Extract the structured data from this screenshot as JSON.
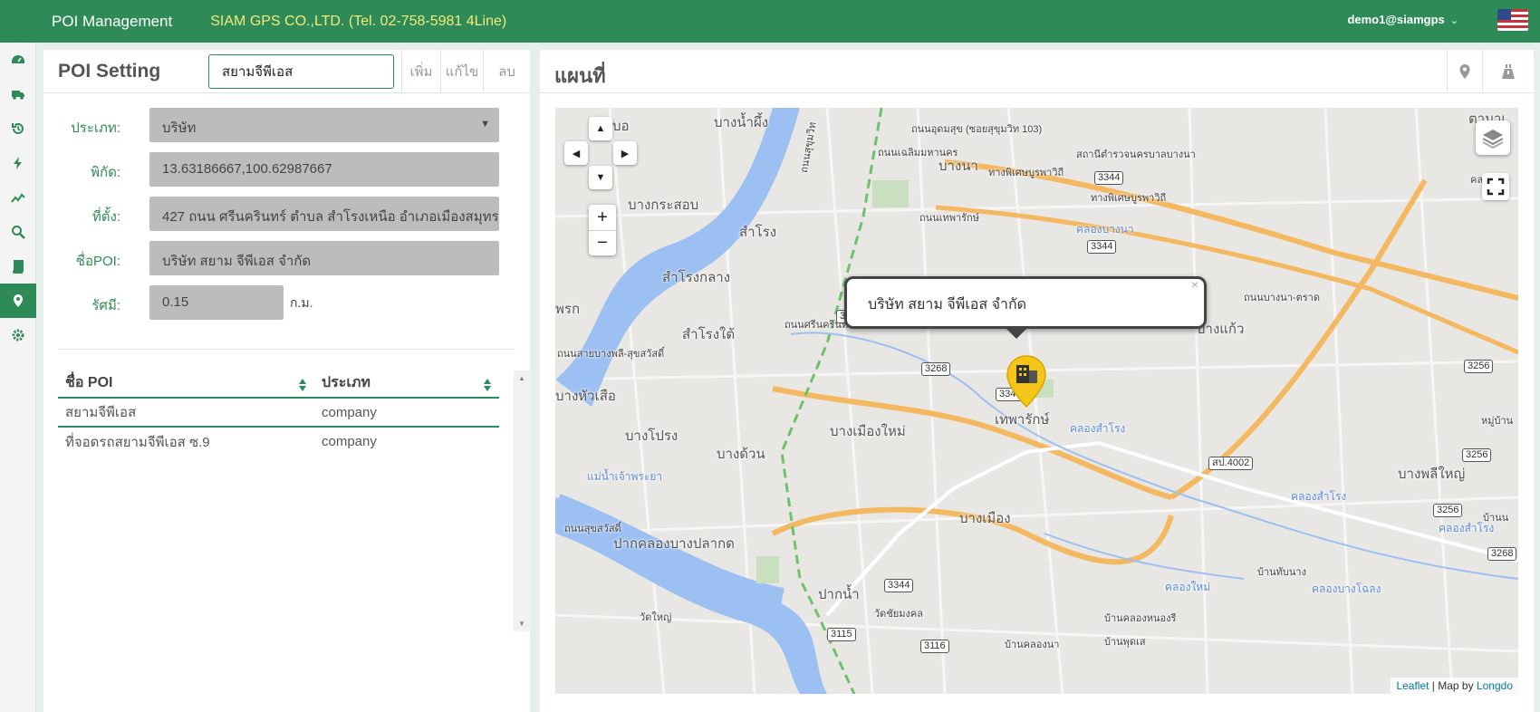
{
  "topbar": {
    "app_title": "POI Management",
    "company": "SIAM GPS CO.,LTD. (Tel. 02-758-5981 4Line)",
    "user": "demo1@siamgps",
    "flag_icon": "us-flag-icon"
  },
  "sidebar": {
    "items": [
      {
        "icon": "dashboard-icon"
      },
      {
        "icon": "truck-icon"
      },
      {
        "icon": "history-icon"
      },
      {
        "icon": "bolt-icon"
      },
      {
        "icon": "chart-line-icon"
      },
      {
        "icon": "search-icon"
      },
      {
        "icon": "book-icon"
      },
      {
        "icon": "map-marker-icon",
        "active": true
      },
      {
        "icon": "gear-icon"
      }
    ]
  },
  "poi_panel": {
    "title": "POI Setting",
    "search_value": "สยามจีพีเอส",
    "add_label": "เพิ่ม",
    "edit_label": "แก้ไข",
    "delete_label": "ลบ",
    "form": {
      "type_label": "ประเภท:",
      "type_value": "บริษัท",
      "coord_label": "พิกัด:",
      "coord_value": "13.63186667,100.62987667",
      "address_label": "ที่ตั้ง:",
      "address_value": "427 ถนน ศรีนครินทร์ ตำบล สำโรงเหนือ อำเภอเมืองสมุทรปราการ",
      "name_label": "ชื่อPOI:",
      "name_value": "บริษัท สยาม จีพีเอส จำกัด",
      "radius_label": "รัศมี:",
      "radius_value": "0.15",
      "radius_unit": "ก.ม."
    },
    "table": {
      "headers": [
        "ชื่อ POI",
        "ประเภท"
      ],
      "rows": [
        {
          "name": "สยามจีพีเอส",
          "type": "company"
        },
        {
          "name": "ที่จอดรถสยามจีพีเอส ซ.9",
          "type": "company"
        }
      ]
    }
  },
  "map_panel": {
    "title": "แผนที่",
    "popup_text": "บริษัท สยาม จีพีเอส จำกัด",
    "popup_close": "×",
    "attribution": {
      "leaflet": "Leaflet",
      "separator": " | Map by ",
      "provider": "Longdo"
    },
    "places": {
      "p1": "บางน้ำผึ้ง",
      "p2": "บางนา",
      "p3": "บางกระสอบ",
      "p4": "สำโรง",
      "p5": "สำโรงกลาง",
      "p6": "สำโรงใต้",
      "p7": "บางแก้ว",
      "p8": "เทพารักษ์",
      "p9": "บางเมืองใหม่",
      "p10": "บางโปรง",
      "p11": "บางด้วน",
      "p12": "บางหัวเสือ",
      "p13": "บางเมือง",
      "p14": "ปากคลองบางปลากด",
      "p15": "ปากน้ำ",
      "p16": "บางพลีใหญ่",
      "p17": "วัดใหญ่",
      "p18": "วัดชัยมงคล",
      "p19": "บ้านคลองหนองรี",
      "p20": "บ้านพุดเส",
      "p21": "บ้านคลองนา",
      "p22": "บ้านทับนาง",
      "p23": "หมู่บ้าน",
      "p24": "ถนนอุดมสุข (ซอยสุขุมวิท 103)",
      "p25": "สถานีตำรวจนครบาลบางนา",
      "p26": "ทางพิเศษบูรพาวิถี",
      "p27": "ถนนสุขุมวิท",
      "p28": "ถนนเทพารักษ์",
      "p29": "ถนนบางนา-ตราด",
      "p30": "แม่น้ำเจ้าพระยา",
      "p31": "คลองบางนา",
      "p32": "คลองสำโรง",
      "p33": "คลองใหม่",
      "p34": "คลองบางโฉลง",
      "p35": "พรก",
      "p36": "บอ",
      "p37": "ตามาเ",
      "p38": "ถนนสายบางพลี-สุขสวัสดิ์",
      "p39": "ถนนศรีนครินทร์",
      "p40": "ถนนเฉลิมมหานคร",
      "p41": "ถนนสุขสวัสดิ์",
      "p42": "คลองสำโรง",
      "p43": "ทางพิเศษบูรพาวิถี",
      "p44": "คลองสำโรง",
      "p45": "คลองนา",
      "p46": "บ้านน"
    },
    "road_badges": [
      "3344",
      "3344",
      "3268",
      "3344",
      "3344",
      "สป.4002",
      "3256",
      "3256",
      "3256",
      "3268",
      "3115",
      "3116",
      "326"
    ]
  }
}
